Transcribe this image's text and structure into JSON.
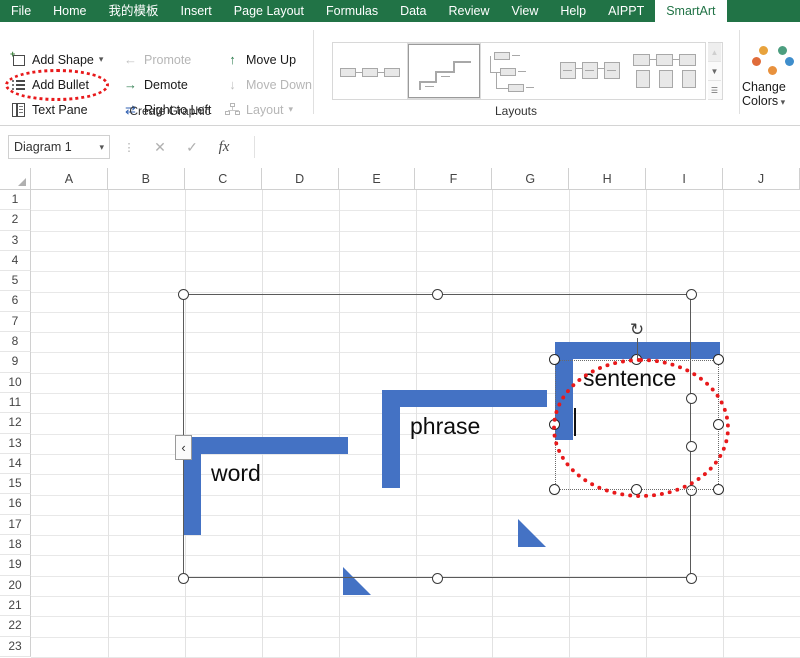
{
  "ribbon": {
    "tabs": [
      {
        "label": "File",
        "active": false
      },
      {
        "label": "Home",
        "active": false
      },
      {
        "label": "我的模板",
        "active": false
      },
      {
        "label": "Insert",
        "active": false
      },
      {
        "label": "Page Layout",
        "active": false
      },
      {
        "label": "Formulas",
        "active": false
      },
      {
        "label": "Data",
        "active": false
      },
      {
        "label": "Review",
        "active": false
      },
      {
        "label": "View",
        "active": false
      },
      {
        "label": "Help",
        "active": false
      },
      {
        "label": "AIPPT",
        "active": false
      },
      {
        "label": "SmartArt",
        "active": true
      }
    ],
    "tab_bar_color": "#217346",
    "create_graphic": {
      "group_label": "Create Graphic",
      "commands": [
        {
          "label": "Add Shape",
          "icon": "add-shape-icon",
          "disabled": false,
          "dropdown": true
        },
        {
          "label": "Add Bullet",
          "icon": "add-bullet-icon",
          "disabled": false,
          "dropdown": false
        },
        {
          "label": "Text Pane",
          "icon": "text-pane-icon",
          "disabled": false,
          "dropdown": false
        },
        {
          "label": "Promote",
          "icon": "arrow-left-icon",
          "disabled": true,
          "dropdown": false
        },
        {
          "label": "Demote",
          "icon": "arrow-right-icon",
          "disabled": false,
          "dropdown": false
        },
        {
          "label": "Right to Left",
          "icon": "swap-arrows-icon",
          "disabled": false,
          "dropdown": false
        },
        {
          "label": "Move Up",
          "icon": "arrow-up-icon",
          "disabled": false,
          "dropdown": false
        },
        {
          "label": "Move Down",
          "icon": "arrow-down-icon",
          "disabled": true,
          "dropdown": false
        },
        {
          "label": "Layout",
          "icon": "layout-icon",
          "disabled": true,
          "dropdown": true
        }
      ]
    },
    "layouts": {
      "group_label": "Layouts",
      "thumbnails": [
        {
          "name": "layout-thumb-1",
          "selected": false
        },
        {
          "name": "layout-thumb-2",
          "selected": true
        },
        {
          "name": "layout-thumb-3",
          "selected": false
        },
        {
          "name": "layout-thumb-4",
          "selected": false
        },
        {
          "name": "layout-thumb-5",
          "selected": false
        }
      ],
      "scroll_buttons": [
        {
          "name": "gallery-scroll-up",
          "glyph": "▲",
          "disabled": true
        },
        {
          "name": "gallery-scroll-down",
          "glyph": "▼",
          "disabled": false
        },
        {
          "name": "gallery-more",
          "glyph": "☰",
          "disabled": false
        }
      ]
    },
    "change_colors": {
      "label_line1": "Change",
      "label_line2": "Colors",
      "dropdown_glyph": "⌄",
      "dots": [
        "#e8a33d",
        "#4c9e7f",
        "#e06c3a",
        "#3f8ecc",
        "#e8913d"
      ]
    }
  },
  "formula_bar": {
    "name_box_value": "Diagram 1",
    "name_box_chevron": "▾",
    "grip_glyph": "⋮",
    "cancel_glyph": "✕",
    "enter_glyph": "✓",
    "fx_glyph": "fx",
    "formula_value": "",
    "formula_placeholder": ""
  },
  "sheet": {
    "columns": [
      "A",
      "B",
      "C",
      "D",
      "E",
      "F",
      "G",
      "H",
      "I",
      "J"
    ],
    "rows": [
      "1",
      "2",
      "3",
      "4",
      "5",
      "6",
      "7",
      "8",
      "9",
      "10",
      "11",
      "12",
      "13",
      "14",
      "15",
      "16",
      "17",
      "18",
      "19",
      "20",
      "21",
      "22",
      "23"
    ],
    "select_all_icon": "select-all-triangle-icon"
  },
  "smartart": {
    "name": "Diagram 1",
    "shape_color": "#4472c4",
    "shapes": [
      {
        "label": "word",
        "name": "smartart-shape-word"
      },
      {
        "label": "phrase",
        "name": "smartart-shape-phrase"
      },
      {
        "label": "sentence",
        "name": "smartart-shape-sentence",
        "selected": true
      }
    ],
    "text_pane_toggle_glyph": "‹",
    "rotate_glyph": "↻"
  },
  "annotations": {
    "color": "#e8191b",
    "items": [
      {
        "name": "annotation-ellipse-add-bullet",
        "target": "Add Bullet"
      },
      {
        "name": "annotation-ellipse-sentence",
        "target": "sentence"
      }
    ]
  }
}
